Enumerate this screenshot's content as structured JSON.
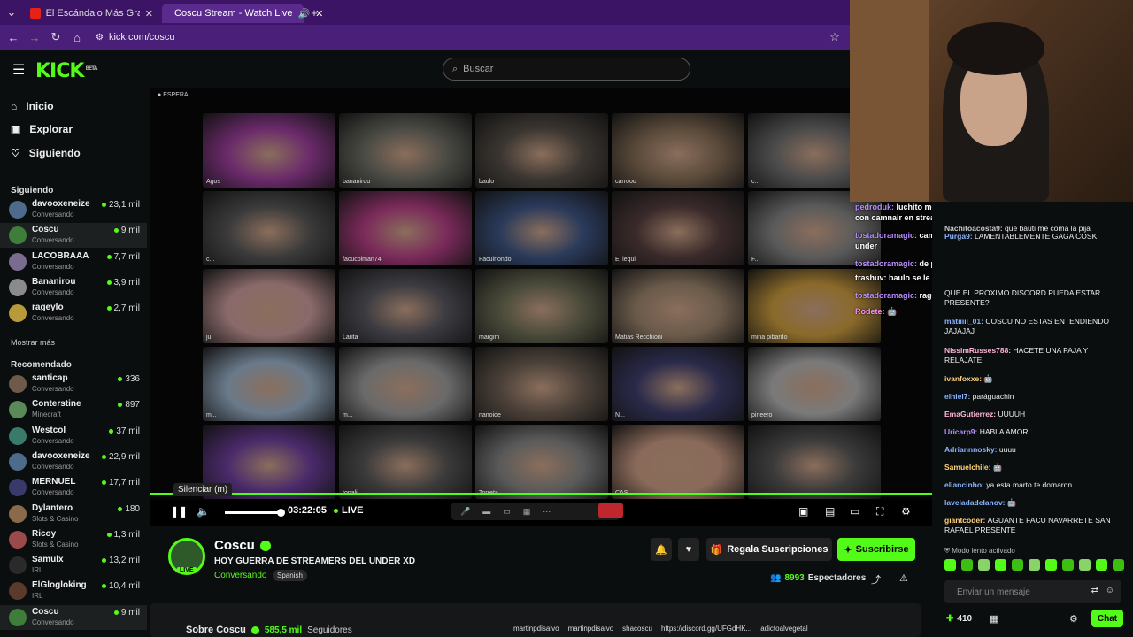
{
  "browser": {
    "tabs": [
      {
        "title": "El Escándalo Más Grande en la"
      },
      {
        "title": "Coscu Stream - Watch Live"
      }
    ],
    "url": "kick.com/coscu"
  },
  "header": {
    "logo": "KICK",
    "logo_badge": "BETA",
    "search_placeholder": "Buscar"
  },
  "sidebar": {
    "nav": [
      {
        "label": "Inicio",
        "icon": "home-icon"
      },
      {
        "label": "Explorar",
        "icon": "compass-icon"
      },
      {
        "label": "Siguiendo",
        "icon": "heart-icon"
      }
    ],
    "following_title": "Siguiendo",
    "following": [
      {
        "name": "davooxeneize",
        "category": "Conversando",
        "viewers": "23,1 mil",
        "color": "#4d6b8a"
      },
      {
        "name": "Coscu",
        "category": "Conversando",
        "viewers": "9 mil",
        "color": "#3f7d3b"
      },
      {
        "name": "LACOBRAAA",
        "category": "Conversando",
        "viewers": "7,7 mil",
        "color": "#7a6c8f"
      },
      {
        "name": "Bananirou",
        "category": "Conversando",
        "viewers": "3,9 mil",
        "color": "#8a8a8a"
      },
      {
        "name": "rageylo",
        "category": "Conversando",
        "viewers": "2,7 mil",
        "color": "#b89a3a"
      }
    ],
    "show_more": "Mostrar más",
    "recommended_title": "Recomendado",
    "recommended": [
      {
        "name": "santicap",
        "category": "Conversando",
        "viewers": "336",
        "color": "#6d5a4a"
      },
      {
        "name": "Conterstine",
        "category": "Minecraft",
        "viewers": "897",
        "color": "#5a8a5a"
      },
      {
        "name": "Westcol",
        "category": "Conversando",
        "viewers": "37 mil",
        "color": "#3a7a6a"
      },
      {
        "name": "davooxeneize",
        "category": "Conversando",
        "viewers": "22,9 mil",
        "color": "#4d6b8a"
      },
      {
        "name": "MERNUEL",
        "category": "Conversando",
        "viewers": "17,7 mil",
        "color": "#3a3a6a"
      },
      {
        "name": "Dylantero",
        "category": "Slots & Casino",
        "viewers": "180",
        "color": "#8a6a4a"
      },
      {
        "name": "Ricoy",
        "category": "Slots & Casino",
        "viewers": "1,3 mil",
        "color": "#9a4a4a"
      },
      {
        "name": "Samulx",
        "category": "IRL",
        "viewers": "13,2 mil",
        "color": "#2a2a2a"
      },
      {
        "name": "ElGlogloking",
        "category": "IRL",
        "viewers": "10,4 mil",
        "color": "#5a3a2a"
      },
      {
        "name": "Coscu",
        "category": "Conversando",
        "viewers": "9 mil",
        "color": "#3f7d3b"
      }
    ]
  },
  "video": {
    "status_label": "ESPERA",
    "tiles": [
      {
        "label": "Agos",
        "color": "#6a2a6a"
      },
      {
        "label": "bananirou",
        "color": "#4a4a44"
      },
      {
        "label": "baulo",
        "color": "#3a3530"
      },
      {
        "label": "carrooo",
        "color": "#5a4a3a"
      },
      {
        "label": "c...",
        "color": "#4a4a4a"
      },
      {
        "label": "c...",
        "color": "#3a3a3a"
      },
      {
        "label": "facucolman74",
        "color": "#7a2a5a"
      },
      {
        "label": "Faculriondo",
        "color": "#2a3a5a"
      },
      {
        "label": "El lequi",
        "color": "#3a2a2a"
      },
      {
        "label": "F...",
        "color": "#5a5a5a"
      },
      {
        "label": "ju",
        "color": "#8a6a6a"
      },
      {
        "label": "Larita",
        "color": "#3a3a40"
      },
      {
        "label": "margim",
        "color": "#4a4a3a"
      },
      {
        "label": "Matias Recchioni",
        "color": "#6a5a4a"
      },
      {
        "label": "mina pibardo",
        "color": "#8a6a2a"
      },
      {
        "label": "m...",
        "color": "#6a7a8a"
      },
      {
        "label": "m...",
        "color": "#6a6a6a"
      },
      {
        "label": "nanoide",
        "color": "#4a4038"
      },
      {
        "label": "N...",
        "color": "#2a2a4a"
      },
      {
        "label": "pineero",
        "color": "#7a7a7a"
      },
      {
        "label": "",
        "color": "#4a2a6a"
      },
      {
        "label": "tonali",
        "color": "#3a3a3a"
      },
      {
        "label": "Torreta",
        "color": "#5a5a5a"
      },
      {
        "label": "CAS",
        "color": "#8a6a5a"
      },
      {
        "label": "",
        "color": "#3a3a3a"
      }
    ],
    "tooltip": "Silenciar (m)",
    "time": "03:22:05",
    "live": "LIVE",
    "volume_fraction": 0.98
  },
  "channel": {
    "name": "Coscu",
    "title": "HOY GUERRA DE STREAMERS DEL UNDER XD",
    "category": "Conversando",
    "language": "Spanish",
    "avatar_badge": "LIVE",
    "gift_label": "Regala Suscripciones",
    "subscribe_label": "Suscribirse",
    "viewers": "8993",
    "viewers_label": "Espectadores",
    "about_title": "Sobre Coscu",
    "followers": "585,5 mil",
    "followers_label": "Seguidores",
    "socials": [
      "martinpdisalvo",
      "martinpdisalvo",
      "shacoscu",
      "https://discord.gg/UFGdHK...",
      "adictoalvegetal"
    ]
  },
  "overlay_chat": [
    {
      "user": "pedroduk:",
      "text": "luchito me informan que 🤖 esta hablando de coger con camnair en stream",
      "ucolor": "#b78cff"
    },
    {
      "user": "tostadoramagic:",
      "text": "camnair dijo que quiere hacer debutar a uno del under",
      "ucolor": "#b78cff"
    },
    {
      "user": "tostadoramagic:",
      "text": "de poder ser que se llame",
      "ucolor": "#b78cff"
    },
    {
      "user": "trashuv:",
      "text": "baulo se le acaba de declarar a camnair",
      "ucolor": "#fff"
    },
    {
      "user": "tostadoramagic:",
      "text": "rageylo",
      "ucolor": "#b78cff"
    },
    {
      "user": "Rodete:",
      "text": "🤖",
      "ucolor": "#ff8cff"
    }
  ],
  "chat": {
    "messages": [
      {
        "user": "Nachitoacosta9:",
        "text": "que bauti me coma la pija",
        "ucolor": "#c8c8c8"
      },
      {
        "user": "Purga9:",
        "text": "LAMENTABLEMENTE GAGA COSKI",
        "ucolor": "#8ab4ff"
      },
      {
        "user": "",
        "text": "QUE EL PROXIMO DISCORD PUEDA ESTAR PRESENTE?",
        "ucolor": "#fff"
      },
      {
        "user": "matiiiii_01:",
        "text": "COSCU NO ESTAS ENTENDIENDO JAJAJAJ",
        "ucolor": "#8ab4ff"
      },
      {
        "user": "NissimRusses788:",
        "text": "HACETE UNA PAJA Y RELAJATE",
        "ucolor": "#ffb3d9"
      },
      {
        "user": "ivanfoxxe:",
        "text": "🤖",
        "ucolor": "#ffd27a"
      },
      {
        "user": "elhiel7:",
        "text": "paráguachin",
        "ucolor": "#8ab4ff"
      },
      {
        "user": "EmaGutierrez:",
        "text": "UUUUH",
        "ucolor": "#ffb3d9"
      },
      {
        "user": "Uricarp9:",
        "text": "HABLA AMOR",
        "ucolor": "#b78cff"
      },
      {
        "user": "Adriannnosky:",
        "text": "uuuu",
        "ucolor": "#8ab4ff"
      },
      {
        "user": "Samuelchile:",
        "text": "🤖",
        "ucolor": "#ffd27a"
      },
      {
        "user": "eliancinho:",
        "text": "ya esta marto te domaron",
        "ucolor": "#8ab4ff"
      },
      {
        "user": "laveladadelanov:",
        "text": "🤖",
        "ucolor": "#8ab4ff"
      },
      {
        "user": "giantcoder:",
        "text": "AGUANTE FACU NAVARRETE SAN RAFAEL PRESENTE",
        "ucolor": "#ffd27a"
      }
    ],
    "slow_mode": "Modo lento activado",
    "input_placeholder": "Enviar un mensaje",
    "points": "410",
    "chat_button": "Chat"
  },
  "colors": {
    "accent": "#53fc18",
    "tabbar": "#3b1466",
    "addrbar": "#4a1f7a"
  }
}
